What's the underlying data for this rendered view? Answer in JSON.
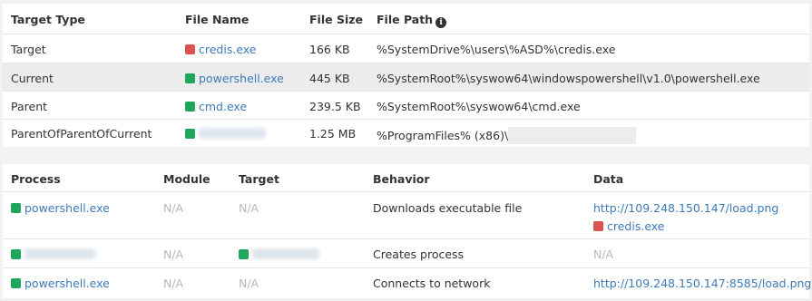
{
  "files": {
    "headers": {
      "target_type": "Target Type",
      "file_name": "File Name",
      "file_size": "File Size",
      "file_path": "File Path"
    },
    "rows": [
      {
        "target_type": "Target",
        "file_name": "credis.exe",
        "status_color": "#d9534f",
        "file_size": "166 KB",
        "file_path": "%SystemDrive%\\users\\%ASD%\\credis.exe"
      },
      {
        "target_type": "Current",
        "file_name": "powershell.exe",
        "status_color": "#20a65c",
        "file_size": "445 KB",
        "file_path": "%SystemRoot%\\syswow64\\windowspowershell\\v1.0\\powershell.exe"
      },
      {
        "target_type": "Parent",
        "file_name": "cmd.exe",
        "status_color": "#20a65c",
        "file_size": "239.5 KB",
        "file_path": "%SystemRoot%\\syswow64\\cmd.exe"
      },
      {
        "target_type": "ParentOfParentOfCurrent",
        "status_color": "#20a65c",
        "file_size": "1.25 MB",
        "file_path": "%ProgramFiles% (x86)\\"
      }
    ]
  },
  "behaviors": {
    "headers": {
      "process": "Process",
      "module": "Module",
      "target": "Target",
      "behavior": "Behavior",
      "data": "Data"
    },
    "rows": [
      {
        "process": "powershell.exe",
        "module": "N/A",
        "target": "N/A",
        "behavior": "Downloads executable file",
        "data_url": "http://109.248.150.147/load.png",
        "data_file": "credis.exe"
      },
      {
        "module": "N/A",
        "behavior": "Creates process",
        "data_na": "N/A"
      },
      {
        "process": "powershell.exe",
        "module": "N/A",
        "target": "N/A",
        "behavior": "Connects to network",
        "data_url": "http://109.248.150.147:8585/load.png"
      }
    ]
  },
  "colors": {
    "link": "#3d7ab8",
    "ok": "#20a65c",
    "danger": "#d9534f",
    "highlight_row": "#ececec"
  }
}
